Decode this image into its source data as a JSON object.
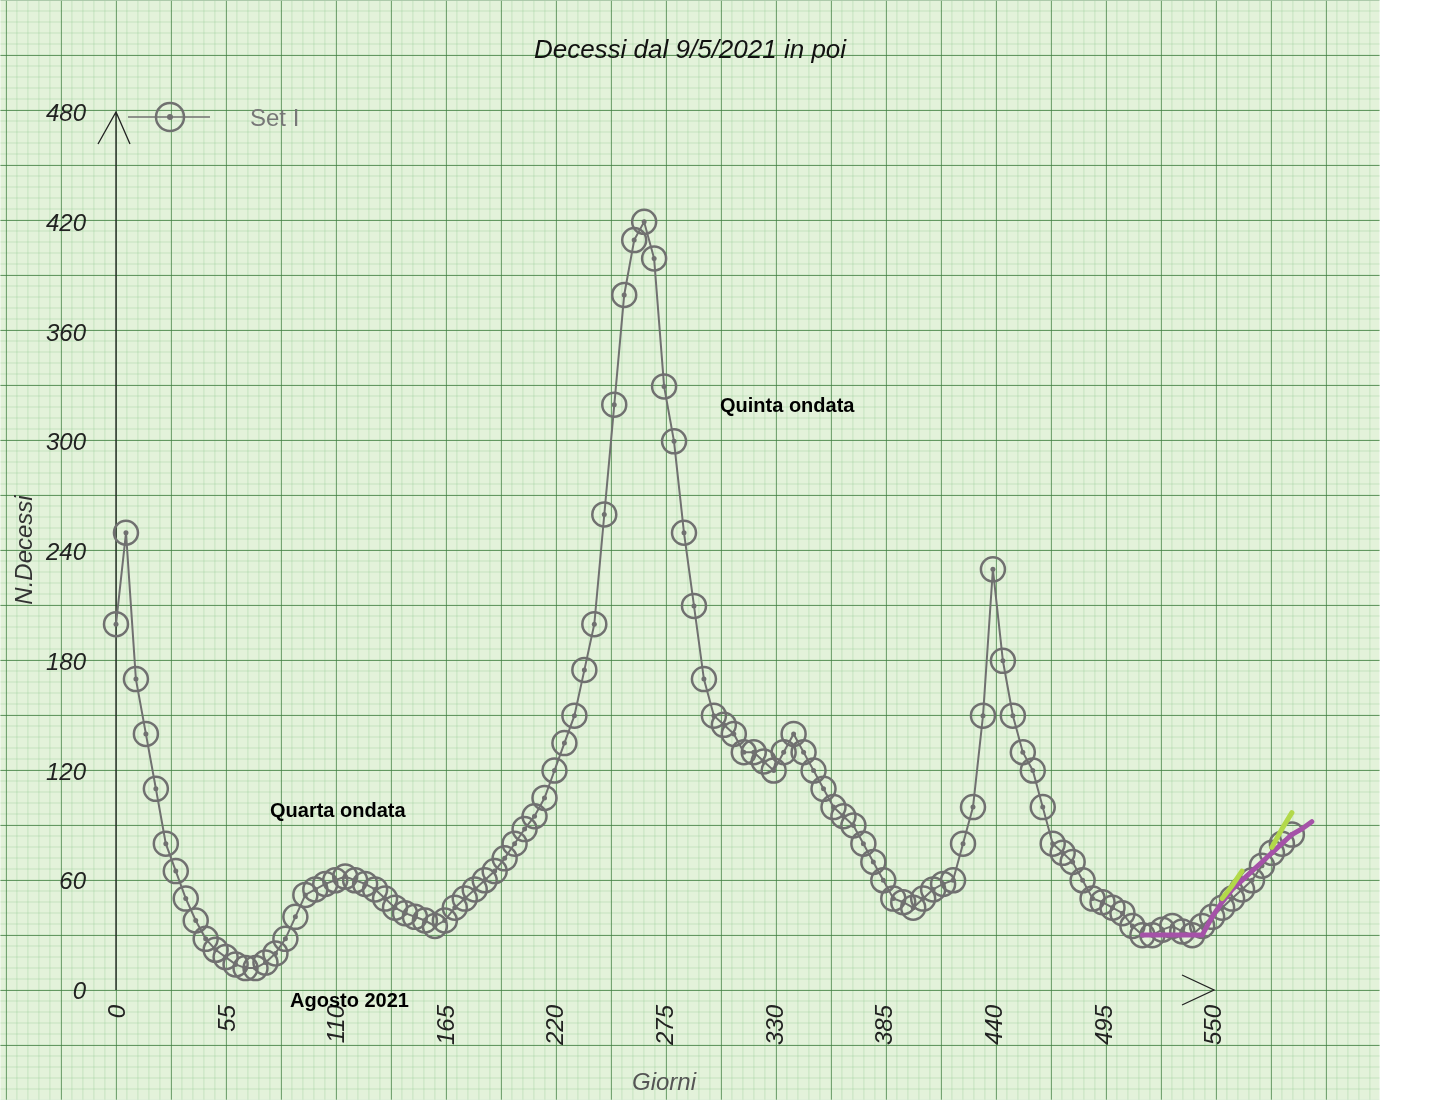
{
  "chart": {
    "chart_data": {
      "type": "line",
      "title": "Decessi dal 9/5/2021 in poi",
      "xlabel": "Giorni",
      "ylabel": "N.Decessi",
      "xlim": [
        -58,
        634
      ],
      "ylim": [
        -60,
        541
      ],
      "xticks": [
        0,
        55,
        110,
        165,
        220,
        275,
        330,
        385,
        440,
        495,
        550
      ],
      "yticks": [
        0,
        60,
        120,
        180,
        240,
        300,
        360,
        420,
        480
      ],
      "x": [
        0,
        5,
        10,
        15,
        20,
        25,
        30,
        35,
        40,
        45,
        50,
        55,
        60,
        65,
        70,
        75,
        80,
        85,
        90,
        95,
        100,
        105,
        110,
        115,
        120,
        125,
        130,
        135,
        140,
        145,
        150,
        155,
        160,
        165,
        170,
        175,
        180,
        185,
        190,
        195,
        200,
        205,
        210,
        215,
        220,
        225,
        230,
        235,
        240,
        245,
        250,
        255,
        260,
        265,
        270,
        275,
        280,
        285,
        290,
        295,
        300,
        305,
        310,
        315,
        320,
        325,
        330,
        335,
        340,
        345,
        350,
        355,
        360,
        365,
        370,
        375,
        380,
        385,
        390,
        395,
        400,
        405,
        410,
        415,
        420,
        425,
        430,
        435,
        440,
        445,
        450,
        455,
        460,
        465,
        470,
        475,
        480,
        485,
        490,
        495,
        500,
        505,
        510,
        515,
        520,
        525,
        530,
        535,
        540,
        545,
        550,
        555,
        560,
        565,
        570,
        575,
        580,
        585,
        590,
        595,
        600
      ],
      "series": [
        {
          "name": "Set I",
          "color": "#707070",
          "marker": "circle",
          "values": [
            200,
            250,
            170,
            140,
            110,
            80,
            65,
            50,
            38,
            28,
            22,
            18,
            14,
            12,
            12,
            15,
            20,
            28,
            40,
            52,
            55,
            58,
            60,
            62,
            60,
            58,
            55,
            50,
            45,
            42,
            40,
            38,
            35,
            38,
            45,
            50,
            55,
            60,
            65,
            72,
            80,
            88,
            95,
            105,
            120,
            135,
            150,
            175,
            200,
            260,
            320,
            380,
            410,
            420,
            400,
            330,
            300,
            250,
            210,
            170,
            150,
            145,
            140,
            130,
            130,
            125,
            120,
            130,
            140,
            130,
            120,
            110,
            100,
            95,
            90,
            80,
            70,
            60,
            50,
            48,
            45,
            50,
            55,
            58,
            60,
            80,
            100,
            150,
            230,
            180,
            150,
            130,
            120,
            100,
            80,
            75,
            70,
            60,
            50,
            48,
            45,
            42,
            35,
            30,
            30,
            33,
            35,
            32,
            30,
            35,
            40,
            45,
            50,
            55,
            60,
            68,
            75,
            80,
            85,
            null,
            null
          ]
        },
        {
          "color": "#a552a8",
          "values": [
            null,
            null,
            null,
            null,
            null,
            null,
            null,
            null,
            null,
            null,
            null,
            null,
            null,
            null,
            null,
            null,
            null,
            null,
            null,
            null,
            null,
            null,
            null,
            null,
            null,
            null,
            null,
            null,
            null,
            null,
            null,
            null,
            null,
            null,
            null,
            null,
            null,
            null,
            null,
            null,
            null,
            null,
            null,
            null,
            null,
            null,
            null,
            null,
            null,
            null,
            null,
            null,
            null,
            null,
            null,
            null,
            null,
            null,
            null,
            null,
            null,
            null,
            null,
            null,
            null,
            null,
            null,
            null,
            null,
            null,
            null,
            null,
            null,
            null,
            null,
            null,
            null,
            null,
            null,
            null,
            null,
            null,
            null,
            null,
            null,
            null,
            null,
            null,
            null,
            null,
            null,
            null,
            null,
            null,
            null,
            null,
            null,
            null,
            null,
            null,
            null,
            null,
            null,
            30,
            30,
            30,
            30,
            30,
            30,
            30,
            40,
            48,
            55,
            60,
            65,
            70,
            75,
            80,
            85,
            88,
            92
          ]
        },
        {
          "color": "#b2d94a",
          "values": [
            null,
            null,
            null,
            null,
            null,
            null,
            null,
            null,
            null,
            null,
            null,
            null,
            null,
            null,
            null,
            null,
            null,
            null,
            null,
            null,
            null,
            null,
            null,
            null,
            null,
            null,
            null,
            null,
            null,
            null,
            null,
            null,
            null,
            null,
            null,
            null,
            null,
            null,
            null,
            null,
            null,
            null,
            null,
            null,
            null,
            null,
            null,
            null,
            null,
            null,
            null,
            null,
            null,
            null,
            null,
            null,
            null,
            null,
            null,
            null,
            null,
            null,
            null,
            null,
            null,
            null,
            null,
            null,
            null,
            null,
            null,
            null,
            null,
            null,
            null,
            null,
            null,
            null,
            null,
            null,
            null,
            null,
            null,
            null,
            null,
            null,
            null,
            null,
            null,
            null,
            null,
            null,
            null,
            null,
            null,
            null,
            null,
            null,
            null,
            null,
            null,
            null,
            null,
            null,
            null,
            null,
            null,
            null,
            null,
            null,
            null,
            50,
            57,
            65,
            null,
            null,
            78,
            88,
            97,
            null,
            null
          ]
        }
      ],
      "annotations": [
        "Quinta ondata",
        "Quarta ondata",
        "Agosto 2021"
      ]
    }
  }
}
